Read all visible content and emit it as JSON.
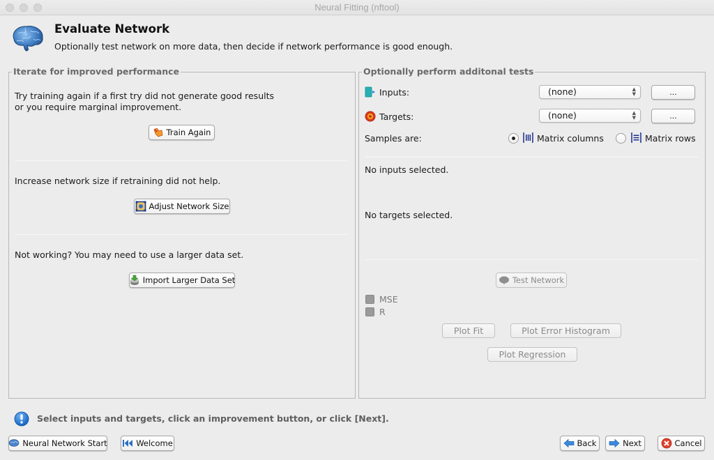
{
  "window": {
    "title": "Neural Fitting (nftool)"
  },
  "header": {
    "icon": "brain-icon",
    "title": "Evaluate Network",
    "subtitle": "Optionally test network on more data, then decide if network performance is good enough."
  },
  "left_panel": {
    "legend": "Iterate for improved performance",
    "sections": [
      {
        "text_lines": [
          "Try training again if a first try did not generate good results",
          "or you require marginal improvement."
        ],
        "button": {
          "label": "Train Again",
          "icon": "train-again-icon"
        }
      },
      {
        "text_lines": [
          "Increase network size if retraining did not help."
        ],
        "button": {
          "label": "Adjust Network Size",
          "icon": "network-size-icon"
        }
      },
      {
        "text_lines": [
          "Not working? You may need to use a larger data set."
        ],
        "button": {
          "label": "Import Larger Data Set",
          "icon": "import-data-icon"
        }
      }
    ]
  },
  "right_panel": {
    "legend": "Optionally perform additonal tests",
    "inputs": {
      "label": "Inputs:",
      "icon": "inputs-icon",
      "selected": "(none)",
      "browse_label": "..."
    },
    "targets": {
      "label": "Targets:",
      "icon": "targets-icon",
      "selected": "(none)",
      "browse_label": "..."
    },
    "samples": {
      "label": "Samples are:",
      "options": [
        {
          "label": "Matrix columns",
          "icon": "matrix-columns-icon",
          "checked": true
        },
        {
          "label": "Matrix rows",
          "icon": "matrix-rows-icon",
          "checked": false
        }
      ]
    },
    "inputs_status": "No inputs selected.",
    "targets_status": "No targets selected.",
    "test_button": {
      "label": "Test Network",
      "icon": "brain-icon",
      "enabled": false
    },
    "results": [
      {
        "label": "MSE",
        "icon": "mse-icon"
      },
      {
        "label": "R",
        "icon": "r-icon"
      }
    ],
    "plot_buttons": {
      "plot_fit": "Plot Fit",
      "plot_error_histogram": "Plot Error Histogram",
      "plot_regression": "Plot Regression"
    }
  },
  "status": {
    "icon": "info-icon",
    "message": "Select inputs and targets, click an improvement button, or click [Next]."
  },
  "footer": {
    "neural_network_start": "Neural Network Start",
    "welcome": "Welcome",
    "back": "Back",
    "next": "Next",
    "cancel": "Cancel"
  }
}
